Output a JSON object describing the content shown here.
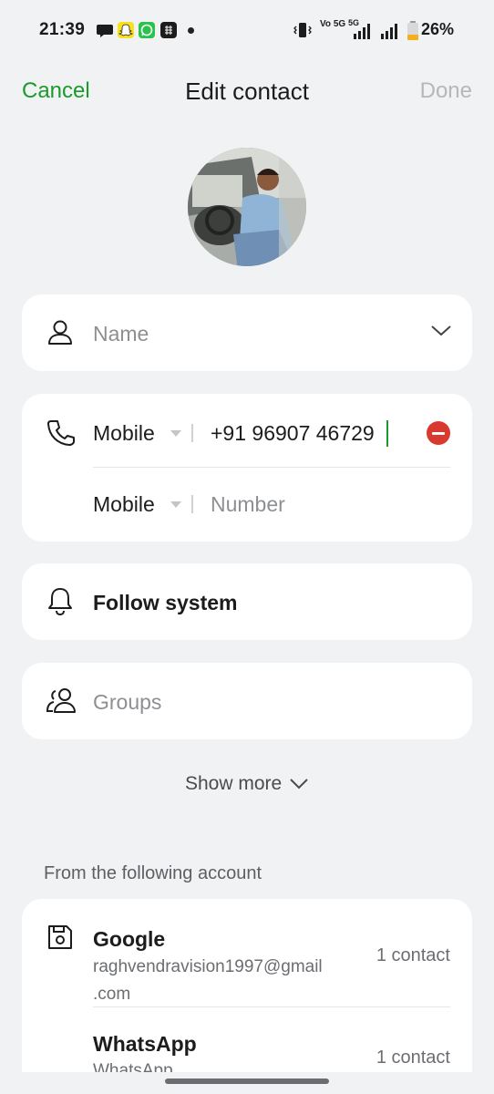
{
  "status_bar": {
    "time": "21:39",
    "network_label": "5G",
    "volte_label": "Vo 5G",
    "battery_percent": "26%"
  },
  "header": {
    "cancel": "Cancel",
    "title": "Edit contact",
    "done": "Done"
  },
  "name_field": {
    "placeholder": "Name"
  },
  "phone": {
    "rows": [
      {
        "type": "Mobile",
        "value": "+91 96907 46729"
      },
      {
        "type": "Mobile",
        "placeholder": "Number"
      }
    ]
  },
  "ringtone": {
    "label": "Follow system"
  },
  "groups": {
    "placeholder": "Groups"
  },
  "show_more": "Show more",
  "accounts": {
    "section_label": "From the following account",
    "items": [
      {
        "name": "Google",
        "email_line1": "raghvendravision1997@gmail",
        "email_line2": ".com",
        "count": "1 contact"
      },
      {
        "name": "WhatsApp",
        "sub": "WhatsApp",
        "count": "1 contact"
      }
    ]
  },
  "colors": {
    "accent": "#1b9a2c",
    "remove_red": "#d93a30",
    "background": "#f1f2f4",
    "card": "#ffffff"
  }
}
